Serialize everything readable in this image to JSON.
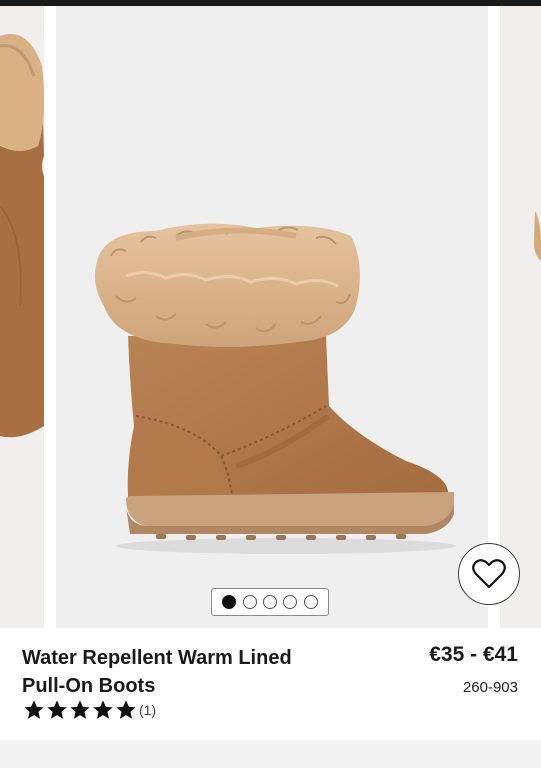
{
  "product": {
    "title_line1": "Water Repellent Warm Lined",
    "title_line2": "Pull-On Boots",
    "price": "€35 - €41",
    "item_code": "260-903",
    "rating": 5,
    "review_count": "(1)"
  },
  "carousel": {
    "slide_count": 5,
    "active_index": 0
  },
  "icons": {
    "wishlist": "heart-icon",
    "rating": "star-icon"
  },
  "colors": {
    "suede": "#b07a4a",
    "fur": "#dcb48a",
    "sole": "#c9a27e",
    "text": "#1a1a1a"
  }
}
